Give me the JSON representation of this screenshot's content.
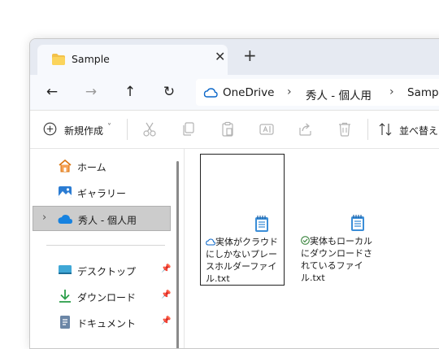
{
  "tab": {
    "title": "Sample",
    "close": "✕",
    "new_tab": "+"
  },
  "nav": {
    "back": "←",
    "forward": "→",
    "up": "↑",
    "refresh": "↻"
  },
  "breadcrumb": {
    "items": [
      "OneDrive",
      "秀人 - 個人用",
      "Sample"
    ],
    "sep": "›"
  },
  "toolbar": {
    "new_label": "新規作成",
    "new_chevron": "˅",
    "sort_label": "並べ替え"
  },
  "sidebar": {
    "items": [
      {
        "label": "ホーム"
      },
      {
        "label": "ギャラリー"
      },
      {
        "label": "秀人 - 個人用"
      },
      {
        "label": "デスクトップ"
      },
      {
        "label": "ダウンロード"
      },
      {
        "label": "ドキュメント"
      }
    ],
    "expand": "›"
  },
  "files": [
    {
      "name": "実体がクラウドにしかないプレースホルダーファイル.txt",
      "status": "cloud-only"
    },
    {
      "name": "実体もローカルにダウンロードされているファイル.txt",
      "status": "available-locally"
    }
  ],
  "colors": {
    "accent": "#0067c0",
    "cloud": "#0a66c8",
    "ok": "#2e7d32",
    "tab_bg": "#e6eaf2"
  }
}
